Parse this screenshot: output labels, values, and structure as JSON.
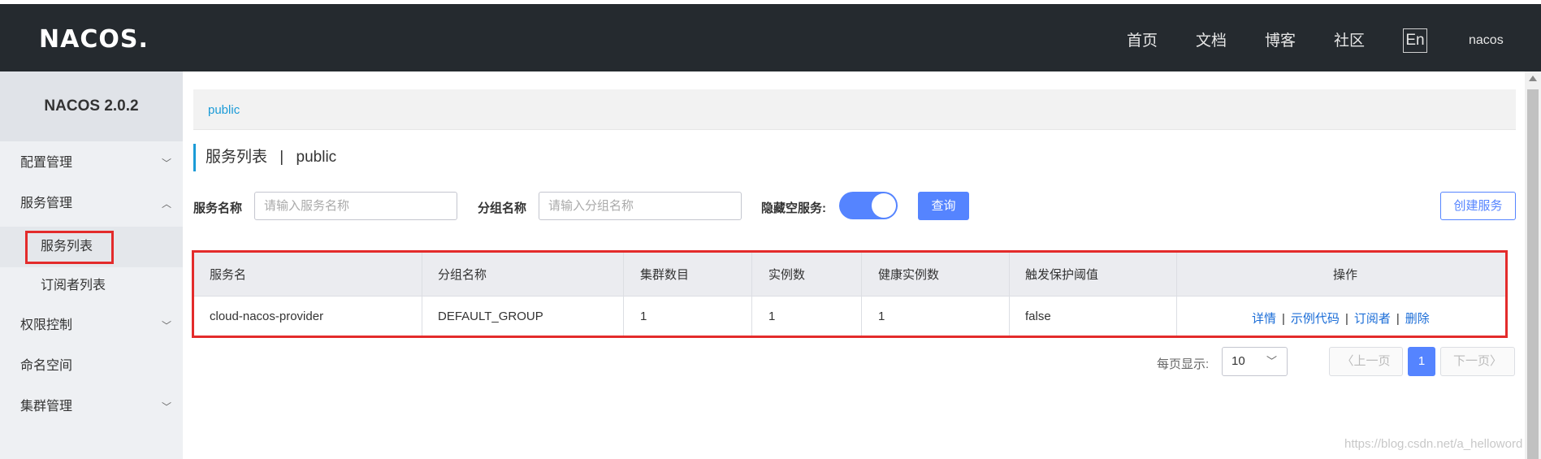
{
  "header": {
    "logo": "NACOS.",
    "nav": [
      "首页",
      "文档",
      "博客",
      "社区"
    ],
    "lang": "En",
    "user": "nacos"
  },
  "sidebar": {
    "title": "NACOS 2.0.2",
    "items": [
      {
        "label": "配置管理"
      },
      {
        "label": "服务管理"
      },
      {
        "label": "服务列表"
      },
      {
        "label": "订阅者列表"
      },
      {
        "label": "权限控制"
      },
      {
        "label": "命名空间"
      },
      {
        "label": "集群管理"
      }
    ]
  },
  "namespace": {
    "current": "public"
  },
  "page": {
    "title": "服务列表",
    "sep": "|",
    "namespace": "public"
  },
  "search": {
    "service_label": "服务名称",
    "service_placeholder": "请输入服务名称",
    "group_label": "分组名称",
    "group_placeholder": "请输入分组名称",
    "hide_empty_label": "隐藏空服务:",
    "hide_empty_on": true,
    "query_button": "查询",
    "create_button": "创建服务"
  },
  "table": {
    "headers": [
      "服务名",
      "分组名称",
      "集群数目",
      "实例数",
      "健康实例数",
      "触发保护阈值",
      "操作"
    ],
    "rows": [
      {
        "service": "cloud-nacos-provider",
        "group": "DEFAULT_GROUP",
        "clusters": "1",
        "instances": "1",
        "healthy": "1",
        "threshold": "false",
        "ops": [
          "详情",
          "示例代码",
          "订阅者",
          "删除"
        ]
      }
    ]
  },
  "pagination": {
    "per_page_label": "每页显示:",
    "per_page": "10",
    "prev": "上一页",
    "current": "1",
    "next": "下一页"
  },
  "watermark": "https://blog.csdn.net/a_helloword"
}
